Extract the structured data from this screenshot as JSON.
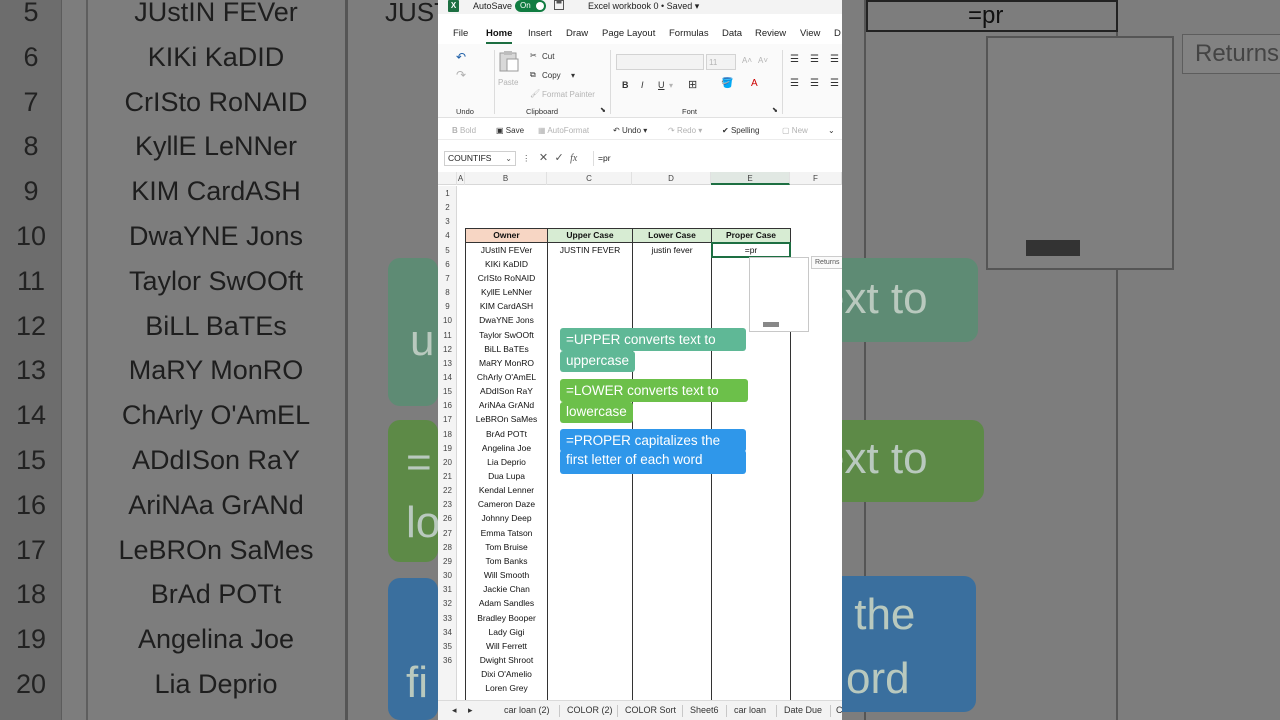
{
  "background": {
    "left_rows": [
      {
        "num": "5",
        "name": "JUstIN FEVer",
        "extra": "JUST"
      },
      {
        "num": "6",
        "name": "KIKi KaDID"
      },
      {
        "num": "7",
        "name": "CrISto RoNAID"
      },
      {
        "num": "8",
        "name": "KyllE LeNNer"
      },
      {
        "num": "9",
        "name": "KIM CardASH"
      },
      {
        "num": "10",
        "name": "DwaYNE Jons"
      },
      {
        "num": "11",
        "name": "Taylor SwOOft"
      },
      {
        "num": "12",
        "name": "BiLL BaTEs"
      },
      {
        "num": "13",
        "name": "MaRY MonRO"
      },
      {
        "num": "14",
        "name": "ChArly O'AmEL"
      },
      {
        "num": "15",
        "name": "ADdISon RaY"
      },
      {
        "num": "16",
        "name": "AriNAa GrANd"
      },
      {
        "num": "17",
        "name": "LeBROn SaMes"
      },
      {
        "num": "18",
        "name": "BrAd POTt"
      },
      {
        "num": "19",
        "name": "Angelina Joe"
      },
      {
        "num": "20",
        "name": "Lia Deprio"
      }
    ],
    "right_cell": "=pr",
    "right_tip": "Returns",
    "right_fragments": [
      "ext to",
      "ext to",
      "s the",
      "ord"
    ],
    "left_fragments": [
      "u",
      "=",
      "lo",
      "fi"
    ]
  },
  "titlebar": {
    "excel_icon": "X",
    "autosave_label": "AutoSave",
    "toggle_label": "On",
    "save_icon": "save-icon",
    "workbook_name": "Excel workbook 0 • Saved",
    "dropdown": "▾"
  },
  "menu": [
    "File",
    "Home",
    "Insert",
    "Draw",
    "Page Layout",
    "Formulas",
    "Data",
    "Review",
    "View",
    "D"
  ],
  "ribbon": {
    "undo_group": "Undo",
    "paste_label": "Paste",
    "cut_label": "Cut",
    "copy_label": "Copy",
    "format_painter_label": "Format Painter",
    "clipboard_group": "Clipboard",
    "font_size": "11",
    "bold": "B",
    "italic": "I",
    "underline": "U",
    "font_group": "Font"
  },
  "qat": {
    "bold": "Bold",
    "save": "Save",
    "autoformat": "AutoFormat",
    "undo": "Undo",
    "redo": "Redo",
    "spelling": "Spelling",
    "new": "New"
  },
  "formula_bar": {
    "name_box": "COUNTIFS",
    "fx": "fx",
    "content": "=pr"
  },
  "columns": [
    "A",
    "B",
    "C",
    "D",
    "E",
    "F"
  ],
  "rows": [
    "1",
    "2",
    "3",
    "4",
    "5",
    "6",
    "7",
    "8",
    "9",
    "10",
    "11",
    "12",
    "13",
    "14",
    "15",
    "16",
    "17",
    "18",
    "19",
    "20",
    "21",
    "22",
    "23",
    "26",
    "27",
    "28",
    "29",
    "30",
    "31",
    "32",
    "33",
    "34",
    "35",
    "36"
  ],
  "table": {
    "headers": [
      "Owner",
      "Upper Case",
      "Lower Case",
      "Proper Case"
    ],
    "row5": {
      "upper": "JUSTIN FEVER",
      "lower": "justin fever",
      "proper": "=pr"
    },
    "owners": [
      "JUstIN FEVer",
      "KIKi KaDID",
      "CrISto RoNAID",
      "KyllE LeNNer",
      "KIM CardASH",
      "DwaYNE Jons",
      "Taylor SwOOft",
      "BiLL BaTEs",
      "MaRY MonRO",
      "ChArly O'AmEL",
      "ADdISon RaY",
      "AriNAa GrANd",
      "LeBROn SaMes",
      "BrAd POTt",
      "Angelina Joe",
      "Lia Deprio",
      "Dua Lupa",
      "Kendal Lenner",
      "Cameron Daze",
      "Johnny Deep",
      "Emma Tatson",
      "Tom Bruise",
      "Tom Banks",
      "Will Smooth",
      "Jackie Chan",
      "Adam Sandles",
      "Bradley Booper",
      "Lady Gigi",
      "Will Ferrett",
      "Dwight Shroot",
      "Dixi O'Amelio",
      "Loren Grey"
    ]
  },
  "autocomplete_tip": "Returns",
  "callouts": [
    {
      "lines": [
        "=UPPER converts text to",
        "uppercase"
      ],
      "color": "#5fb896"
    },
    {
      "lines": [
        "=LOWER converts text to",
        "lowercase"
      ],
      "color": "#6cc04a"
    },
    {
      "lines": [
        "=PROPER capitalizes the",
        "first letter of each word"
      ],
      "color": "#2f97ea"
    }
  ],
  "sheet_tabs": [
    "car loan (2)",
    "COLOR (2)",
    "COLOR Sort",
    "Sheet6",
    "car loan",
    "Date Due",
    "C"
  ]
}
